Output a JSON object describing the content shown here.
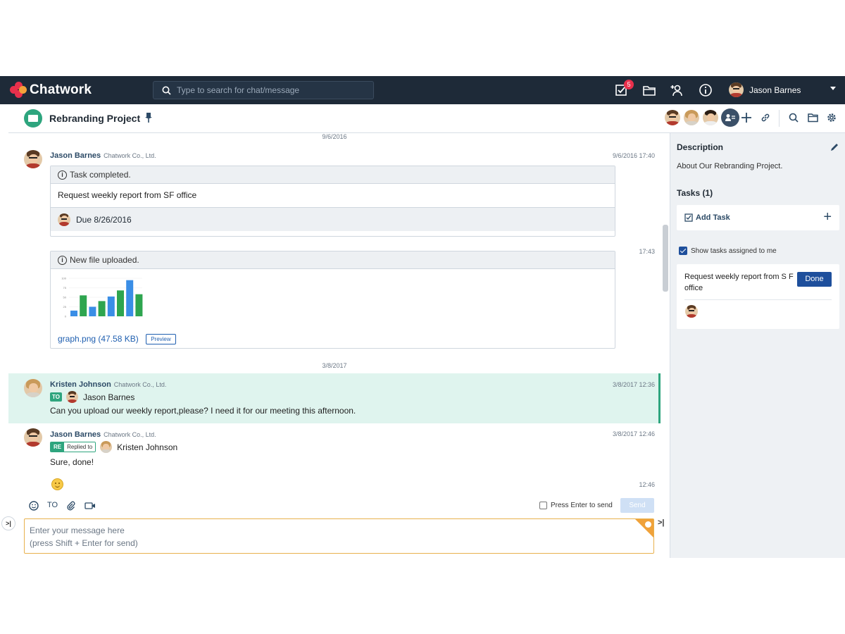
{
  "app": {
    "name": "Chatwork"
  },
  "topbar": {
    "search_placeholder": "Type to search for chat/message",
    "task_badge": "5",
    "user_name": "Jason Barnes",
    "icons": [
      "task-icon",
      "folder-icon",
      "contacts-icon",
      "info-icon"
    ]
  },
  "room": {
    "title": "Rebranding Project"
  },
  "timeline": {
    "date1": "9/6/2016",
    "date2": "3/8/2017",
    "messages": [
      {
        "name": "Jason Barnes",
        "org": "Chatwork Co., Ltd.",
        "time": "9/6/2016 17:40",
        "task_head": "Task completed.",
        "task_body": "Request weekly report from SF office",
        "task_due": "Due 8/26/2016"
      },
      {
        "time": "17:43",
        "file_head": "New file uploaded.",
        "file_name": "graph.png (47.58 KB)",
        "preview_label": "Preview"
      },
      {
        "name": "Kristen Johnson",
        "org": "Chatwork Co., Ltd.",
        "time": "3/8/2017 12:36",
        "to_label": "TO",
        "to_name": "Jason Barnes",
        "text": "Can you upload our weekly report,please? I need it for our meeting this afternoon."
      },
      {
        "name": "Jason Barnes",
        "org": "Chatwork Co., Ltd.",
        "time": "3/8/2017 12:46",
        "re_label": "RE",
        "replied_label": "Replied to",
        "reply_name": "Kristen Johnson",
        "text": "Sure, done!"
      },
      {
        "time": "12:46"
      }
    ]
  },
  "thumbnail_chart": {
    "tick_labels": [
      "100",
      "75",
      "50",
      "25",
      "0"
    ],
    "bars": [
      {
        "value": 15,
        "color": "#3a8ee6"
      },
      {
        "value": 55,
        "color": "#2ea54f"
      },
      {
        "value": 25,
        "color": "#3a8ee6"
      },
      {
        "value": 40,
        "color": "#2ea54f"
      },
      {
        "value": 52,
        "color": "#3a8ee6"
      },
      {
        "value": 68,
        "color": "#2ea54f"
      },
      {
        "value": 95,
        "color": "#3a8ee6"
      },
      {
        "value": 58,
        "color": "#2ea54f"
      }
    ]
  },
  "composer": {
    "toolbar_to": "TO",
    "enter_label": "Press Enter to send",
    "send_label": "Send",
    "placeholder_line1": "Enter your message here",
    "placeholder_line2": "(press Shift + Enter for send)"
  },
  "sidebar": {
    "description_title": "Description",
    "description_text": "About Our Rebranding Project.",
    "tasks_title": "Tasks (1)",
    "add_task_label": "Add Task",
    "show_tasks_label": "Show tasks assigned to me",
    "task_text": "Request weekly report from S F office",
    "done_label": "Done"
  },
  "colors": {
    "topbar": "#1e2a38",
    "accent_green": "#2ea57e",
    "accent_blue": "#1e4f9c",
    "brand_red": "#e8304c"
  }
}
